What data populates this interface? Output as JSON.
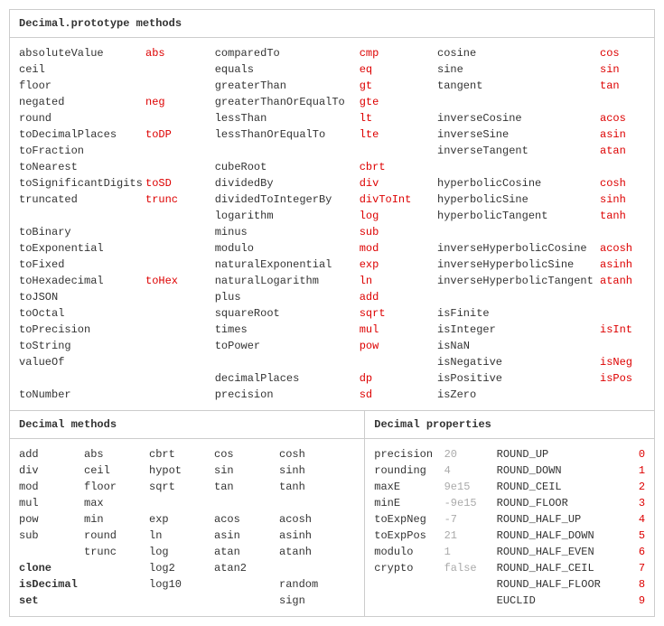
{
  "top": {
    "title": "Decimal.prototype methods",
    "col1": [
      {
        "name": "absoluteValue",
        "alias": "abs"
      },
      {
        "name": "ceil",
        "alias": ""
      },
      {
        "name": "floor",
        "alias": ""
      },
      {
        "name": "negated",
        "alias": "neg"
      },
      {
        "name": "round",
        "alias": ""
      },
      {
        "name": "toDecimalPlaces",
        "alias": "toDP"
      },
      {
        "name": "toFraction",
        "alias": ""
      },
      {
        "name": "toNearest",
        "alias": ""
      },
      {
        "name": "toSignificantDigits",
        "alias": "toSD"
      },
      {
        "name": "truncated",
        "alias": "trunc"
      },
      {
        "name": "",
        "alias": ""
      },
      {
        "name": "toBinary",
        "alias": ""
      },
      {
        "name": "toExponential",
        "alias": ""
      },
      {
        "name": "toFixed",
        "alias": ""
      },
      {
        "name": "toHexadecimal",
        "alias": "toHex"
      },
      {
        "name": "toJSON",
        "alias": ""
      },
      {
        "name": "toOctal",
        "alias": ""
      },
      {
        "name": "toPrecision",
        "alias": ""
      },
      {
        "name": "toString",
        "alias": ""
      },
      {
        "name": "valueOf",
        "alias": ""
      },
      {
        "name": "",
        "alias": ""
      },
      {
        "name": "toNumber",
        "alias": ""
      }
    ],
    "col2": [
      {
        "name": "comparedTo",
        "alias": "cmp"
      },
      {
        "name": "equals",
        "alias": "eq"
      },
      {
        "name": "greaterThan",
        "alias": "gt"
      },
      {
        "name": "greaterThanOrEqualTo",
        "alias": "gte"
      },
      {
        "name": "lessThan",
        "alias": "lt"
      },
      {
        "name": "lessThanOrEqualTo",
        "alias": "lte"
      },
      {
        "name": "",
        "alias": ""
      },
      {
        "name": "cubeRoot",
        "alias": "cbrt"
      },
      {
        "name": "dividedBy",
        "alias": "div"
      },
      {
        "name": "dividedToIntegerBy",
        "alias": "divToInt"
      },
      {
        "name": "logarithm",
        "alias": "log"
      },
      {
        "name": "minus",
        "alias": "sub"
      },
      {
        "name": "modulo",
        "alias": "mod"
      },
      {
        "name": "naturalExponential",
        "alias": "exp"
      },
      {
        "name": "naturalLogarithm",
        "alias": "ln"
      },
      {
        "name": "plus",
        "alias": "add"
      },
      {
        "name": "squareRoot",
        "alias": "sqrt"
      },
      {
        "name": "times",
        "alias": "mul"
      },
      {
        "name": "toPower",
        "alias": "pow"
      },
      {
        "name": "",
        "alias": ""
      },
      {
        "name": "decimalPlaces",
        "alias": "dp"
      },
      {
        "name": "precision",
        "alias": "sd"
      }
    ],
    "col3": [
      {
        "name": "cosine",
        "alias": "cos"
      },
      {
        "name": "sine",
        "alias": "sin"
      },
      {
        "name": "tangent",
        "alias": "tan"
      },
      {
        "name": "",
        "alias": ""
      },
      {
        "name": "inverseCosine",
        "alias": "acos"
      },
      {
        "name": "inverseSine",
        "alias": "asin"
      },
      {
        "name": "inverseTangent",
        "alias": "atan"
      },
      {
        "name": "",
        "alias": ""
      },
      {
        "name": "hyperbolicCosine",
        "alias": "cosh"
      },
      {
        "name": "hyperbolicSine",
        "alias": "sinh"
      },
      {
        "name": "hyperbolicTangent",
        "alias": "tanh"
      },
      {
        "name": "",
        "alias": ""
      },
      {
        "name": "inverseHyperbolicCosine",
        "alias": "acosh"
      },
      {
        "name": "inverseHyperbolicSine",
        "alias": "asinh"
      },
      {
        "name": "inverseHyperbolicTangent",
        "alias": "atanh"
      },
      {
        "name": "",
        "alias": ""
      },
      {
        "name": "isFinite",
        "alias": ""
      },
      {
        "name": "isInteger",
        "alias": "isInt"
      },
      {
        "name": "isNaN",
        "alias": ""
      },
      {
        "name": "isNegative",
        "alias": "isNeg"
      },
      {
        "name": "isPositive",
        "alias": "isPos"
      },
      {
        "name": "isZero",
        "alias": ""
      }
    ]
  },
  "dm": {
    "title": "Decimal methods",
    "rows": [
      [
        "add",
        "abs",
        "cbrt",
        "cos",
        "cosh"
      ],
      [
        "div",
        "ceil",
        "hypot",
        "sin",
        "sinh"
      ],
      [
        "mod",
        "floor",
        "sqrt",
        "tan",
        "tanh"
      ],
      [
        "mul",
        "max",
        "",
        "",
        ""
      ],
      [
        "pow",
        "min",
        "exp",
        "acos",
        "acosh"
      ],
      [
        "sub",
        "round",
        "ln",
        "asin",
        "asinh"
      ],
      [
        "",
        "trunc",
        "log",
        "atan",
        "atanh"
      ],
      [
        "clone",
        "",
        "log2",
        "atan2",
        ""
      ],
      [
        "isDecimal",
        "",
        "log10",
        "",
        "random"
      ],
      [
        "set",
        "",
        "",
        "",
        "sign"
      ]
    ],
    "boldCol0": [
      "clone",
      "isDecimal",
      "set"
    ]
  },
  "dp": {
    "title": "Decimal properties",
    "rows": [
      {
        "k": "precision",
        "v": "20",
        "r": "ROUND_UP",
        "n": "0"
      },
      {
        "k": "rounding",
        "v": "4",
        "r": "ROUND_DOWN",
        "n": "1"
      },
      {
        "k": "maxE",
        "v": "9e15",
        "r": "ROUND_CEIL",
        "n": "2"
      },
      {
        "k": "minE",
        "v": "-9e15",
        "r": "ROUND_FLOOR",
        "n": "3"
      },
      {
        "k": "toExpNeg",
        "v": "-7",
        "r": "ROUND_HALF_UP",
        "n": "4"
      },
      {
        "k": "toExpPos",
        "v": "21",
        "r": "ROUND_HALF_DOWN",
        "n": "5"
      },
      {
        "k": "modulo",
        "v": "1",
        "r": "ROUND_HALF_EVEN",
        "n": "6"
      },
      {
        "k": "crypto",
        "v": "false",
        "r": "ROUND_HALF_CEIL",
        "n": "7"
      },
      {
        "k": "",
        "v": "",
        "r": "ROUND_HALF_FLOOR",
        "n": "8"
      },
      {
        "k": "",
        "v": "",
        "r": "EUCLID",
        "n": "9"
      }
    ]
  }
}
